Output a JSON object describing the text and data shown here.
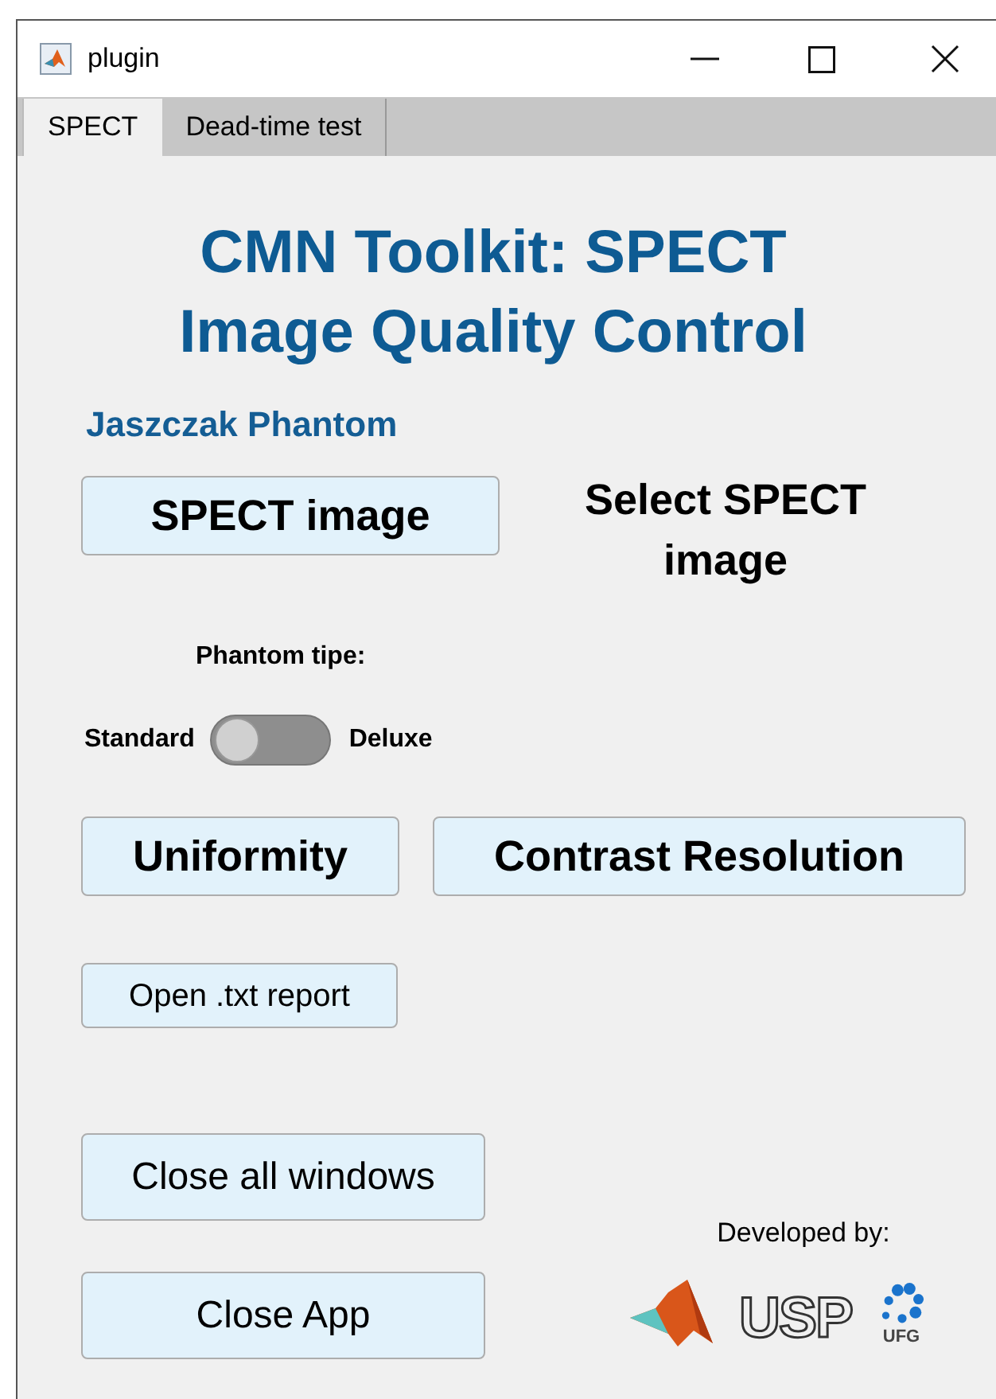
{
  "window": {
    "title": "plugin"
  },
  "tabs": [
    {
      "label": "SPECT",
      "selected": true
    },
    {
      "label": "Dead-time test",
      "selected": false
    }
  ],
  "heading": [
    "CMN Toolkit: SPECT",
    "Image Quality Control"
  ],
  "section_label": "Jaszczak Phantom",
  "spect_image_button": "SPECT image",
  "status_text": "Select SPECT image",
  "phantom_type": {
    "label": "Phantom tipe:",
    "left_label": "Standard",
    "right_label": "Deluxe",
    "on": false
  },
  "analysis_buttons": [
    "Uniformity",
    "Contrast Resolution"
  ],
  "report_button": "Open .txt report",
  "close_windows_button": "Close all windows",
  "close_app_button": "Close App",
  "credits": {
    "label": "Developed by:",
    "logos": [
      {
        "kind": "matlab"
      },
      {
        "kind": "usp",
        "text": "USP"
      },
      {
        "kind": "ufg",
        "text": "UFG"
      }
    ]
  }
}
